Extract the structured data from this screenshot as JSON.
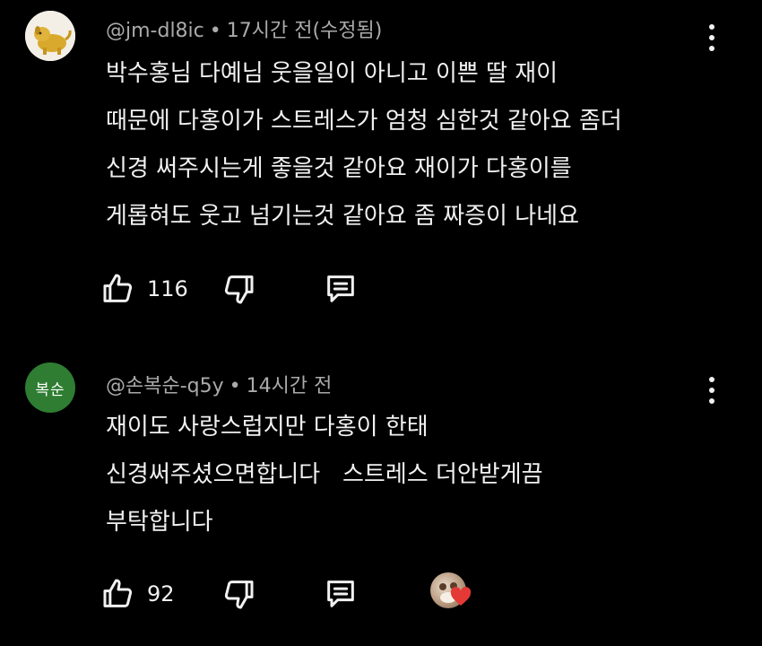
{
  "comments": [
    {
      "author": "@jm-dl8ic",
      "time": "17시간 전(수정됨)",
      "lines": [
        "박수홍님 다예님 웃을일이 아니고 이쁜 딸 재이",
        "때문에 다홍이가 스트레스가 엄청 심한것 같아요 좀더",
        "신경 써주시는게 좋을것 같아요 재이가 다홍이를",
        "게롭혀도 웃고 넘기는것 같아요 좀 짜증이 나네요"
      ],
      "likes": "116",
      "avatar_icon": "golden-dog-avatar-icon"
    },
    {
      "author": "@손복순-q5y",
      "time": "14시간 전",
      "avatar_text": "복순",
      "avatar_color": "#2e7d32",
      "lines": [
        "재이도 사랑스럽지만 다홍이 한태",
        "신경써주셨으면합니다   스트레스 더안받게끔",
        "부탁합니다"
      ],
      "likes": "92",
      "creator_heart": true
    }
  ],
  "meta_separator": "•",
  "icons": {
    "like": "thumbs-up-icon",
    "dislike": "thumbs-down-icon",
    "reply": "reply-icon",
    "more": "more-vertical-icon",
    "heart": "heart-icon"
  },
  "colors": {
    "background": "#000000",
    "text": "#f1f1f1",
    "meta": "#aaaaaa",
    "heart": "#e53935"
  }
}
